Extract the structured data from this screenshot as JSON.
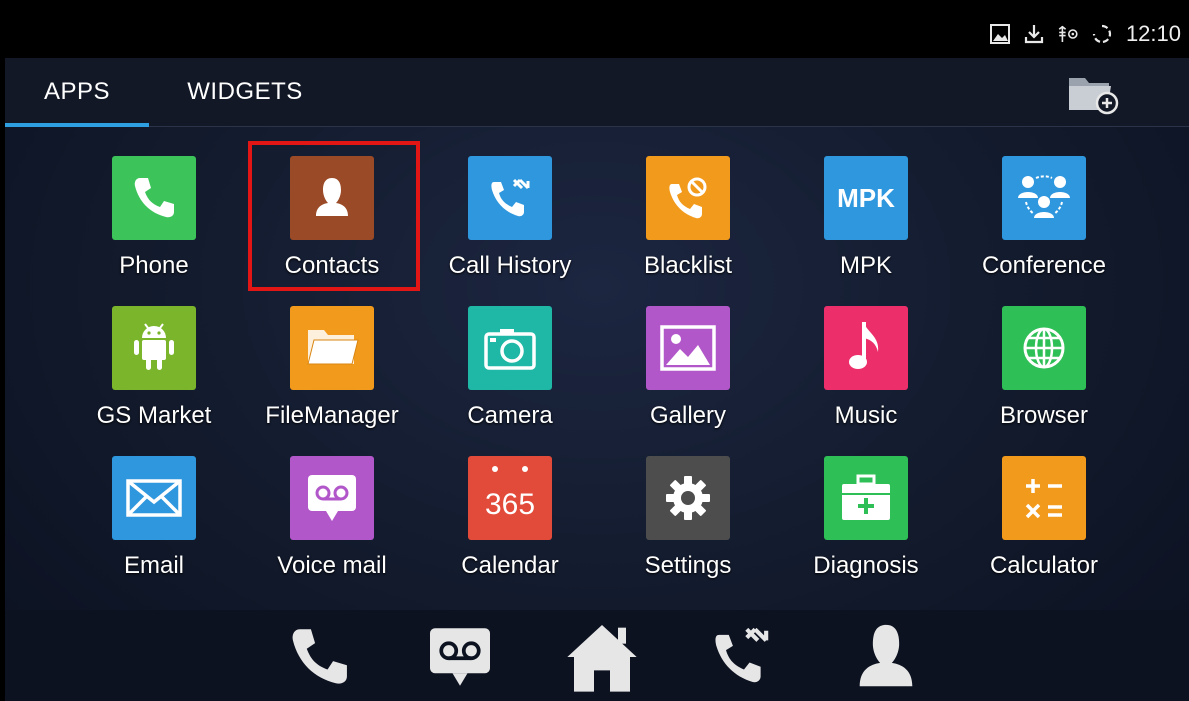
{
  "status_bar": {
    "time": "12:10",
    "icons": [
      "image-icon",
      "download-icon",
      "usb-debug-icon",
      "sync-icon"
    ]
  },
  "tabs": {
    "apps_label": "APPS",
    "widgets_label": "WIDGETS",
    "active": "APPS"
  },
  "apps": [
    {
      "label": "Phone",
      "color": "#3cc45a",
      "icon": "phone-icon"
    },
    {
      "label": "Contacts",
      "color": "#9a4a26",
      "icon": "contact-person-icon",
      "highlighted": true
    },
    {
      "label": "Call History",
      "color": "#2f97de",
      "icon": "call-history-icon"
    },
    {
      "label": "Blacklist",
      "color": "#f29a1c",
      "icon": "blocked-call-icon"
    },
    {
      "label": "MPK",
      "color": "#2f97de",
      "icon": "mpk-icon",
      "icon_text": "MPK"
    },
    {
      "label": "Conference",
      "color": "#2f97de",
      "icon": "conference-icon"
    },
    {
      "label": "GS Market",
      "color": "#7ab52c",
      "icon": "android-icon"
    },
    {
      "label": "FileManager",
      "color": "#f29a1c",
      "icon": "folder-icon"
    },
    {
      "label": "Camera",
      "color": "#1fb8a6",
      "icon": "camera-icon"
    },
    {
      "label": "Gallery",
      "color": "#b257c9",
      "icon": "gallery-icon"
    },
    {
      "label": "Music",
      "color": "#ec2f6b",
      "icon": "music-note-icon"
    },
    {
      "label": "Browser",
      "color": "#2fbf57",
      "icon": "globe-icon"
    },
    {
      "label": "Email",
      "color": "#2f97de",
      "icon": "envelope-icon"
    },
    {
      "label": "Voice mail",
      "color": "#b257c9",
      "icon": "voicemail-icon"
    },
    {
      "label": "Calendar",
      "color": "#e24a3a",
      "icon": "calendar-icon",
      "icon_text": "365"
    },
    {
      "label": "Settings",
      "color": "#4d4d4d",
      "icon": "gear-icon"
    },
    {
      "label": "Diagnosis",
      "color": "#2fbf57",
      "icon": "first-aid-kit-icon"
    },
    {
      "label": "Calculator",
      "color": "#f29a1c",
      "icon": "calculator-icon"
    }
  ],
  "dock": [
    "phone-icon",
    "voicemail-icon",
    "home-icon",
    "call-history-icon",
    "contact-person-icon"
  ]
}
